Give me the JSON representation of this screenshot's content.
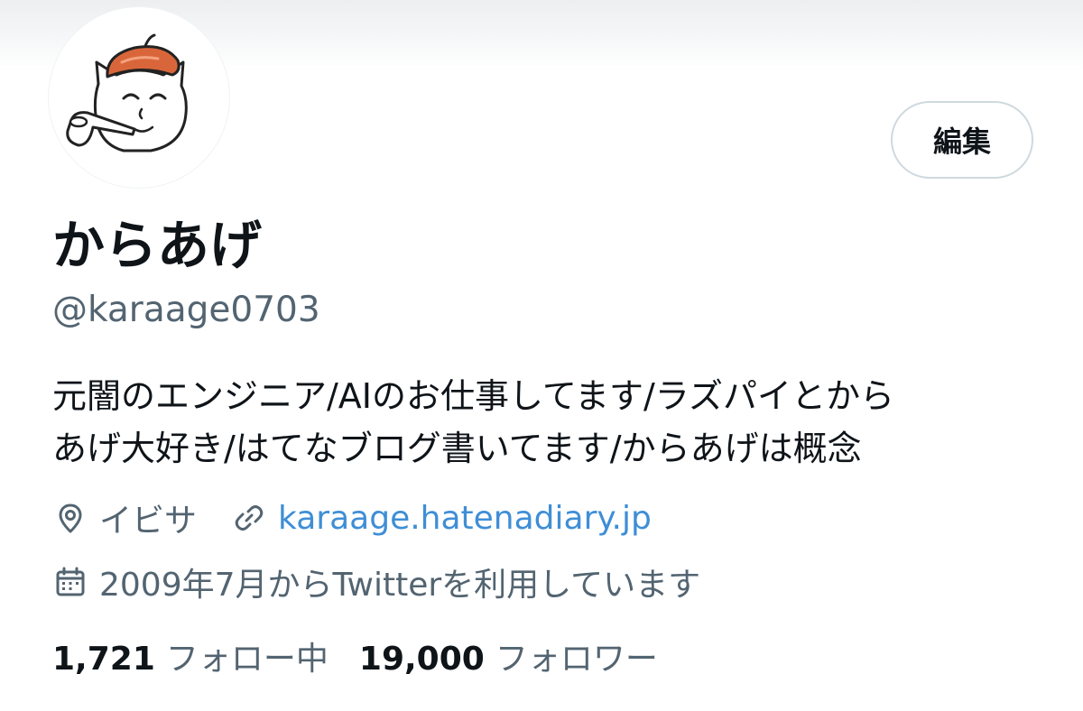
{
  "profile": {
    "display_name": "からあげ",
    "handle": "@karaage0703",
    "bio_line1": "元闇のエンジニア/AIのお仕事してます/ラズパイとから",
    "bio_line2": "あげ大好き/はてなブログ書いてます/からあげは概念",
    "avatar_icon": "cat-with-beret-and-pipe-avatar"
  },
  "actions": {
    "edit_label": "編集"
  },
  "meta": {
    "location": "イビサ",
    "location_icon": "location-pin-icon",
    "website": "karaage.hatenadiary.jp",
    "website_icon": "link-icon",
    "joined": "2009年7月からTwitterを利用しています",
    "joined_icon": "calendar-icon"
  },
  "stats": {
    "following_count": "1,721",
    "following_label": "フォロー中",
    "followers_count": "19,000",
    "followers_label": "フォロワー"
  },
  "colors": {
    "text_primary": "#0f1419",
    "text_secondary": "#536471",
    "link": "#3f8ed6",
    "button_border": "#cfd9de",
    "beret": "#d9663a"
  }
}
